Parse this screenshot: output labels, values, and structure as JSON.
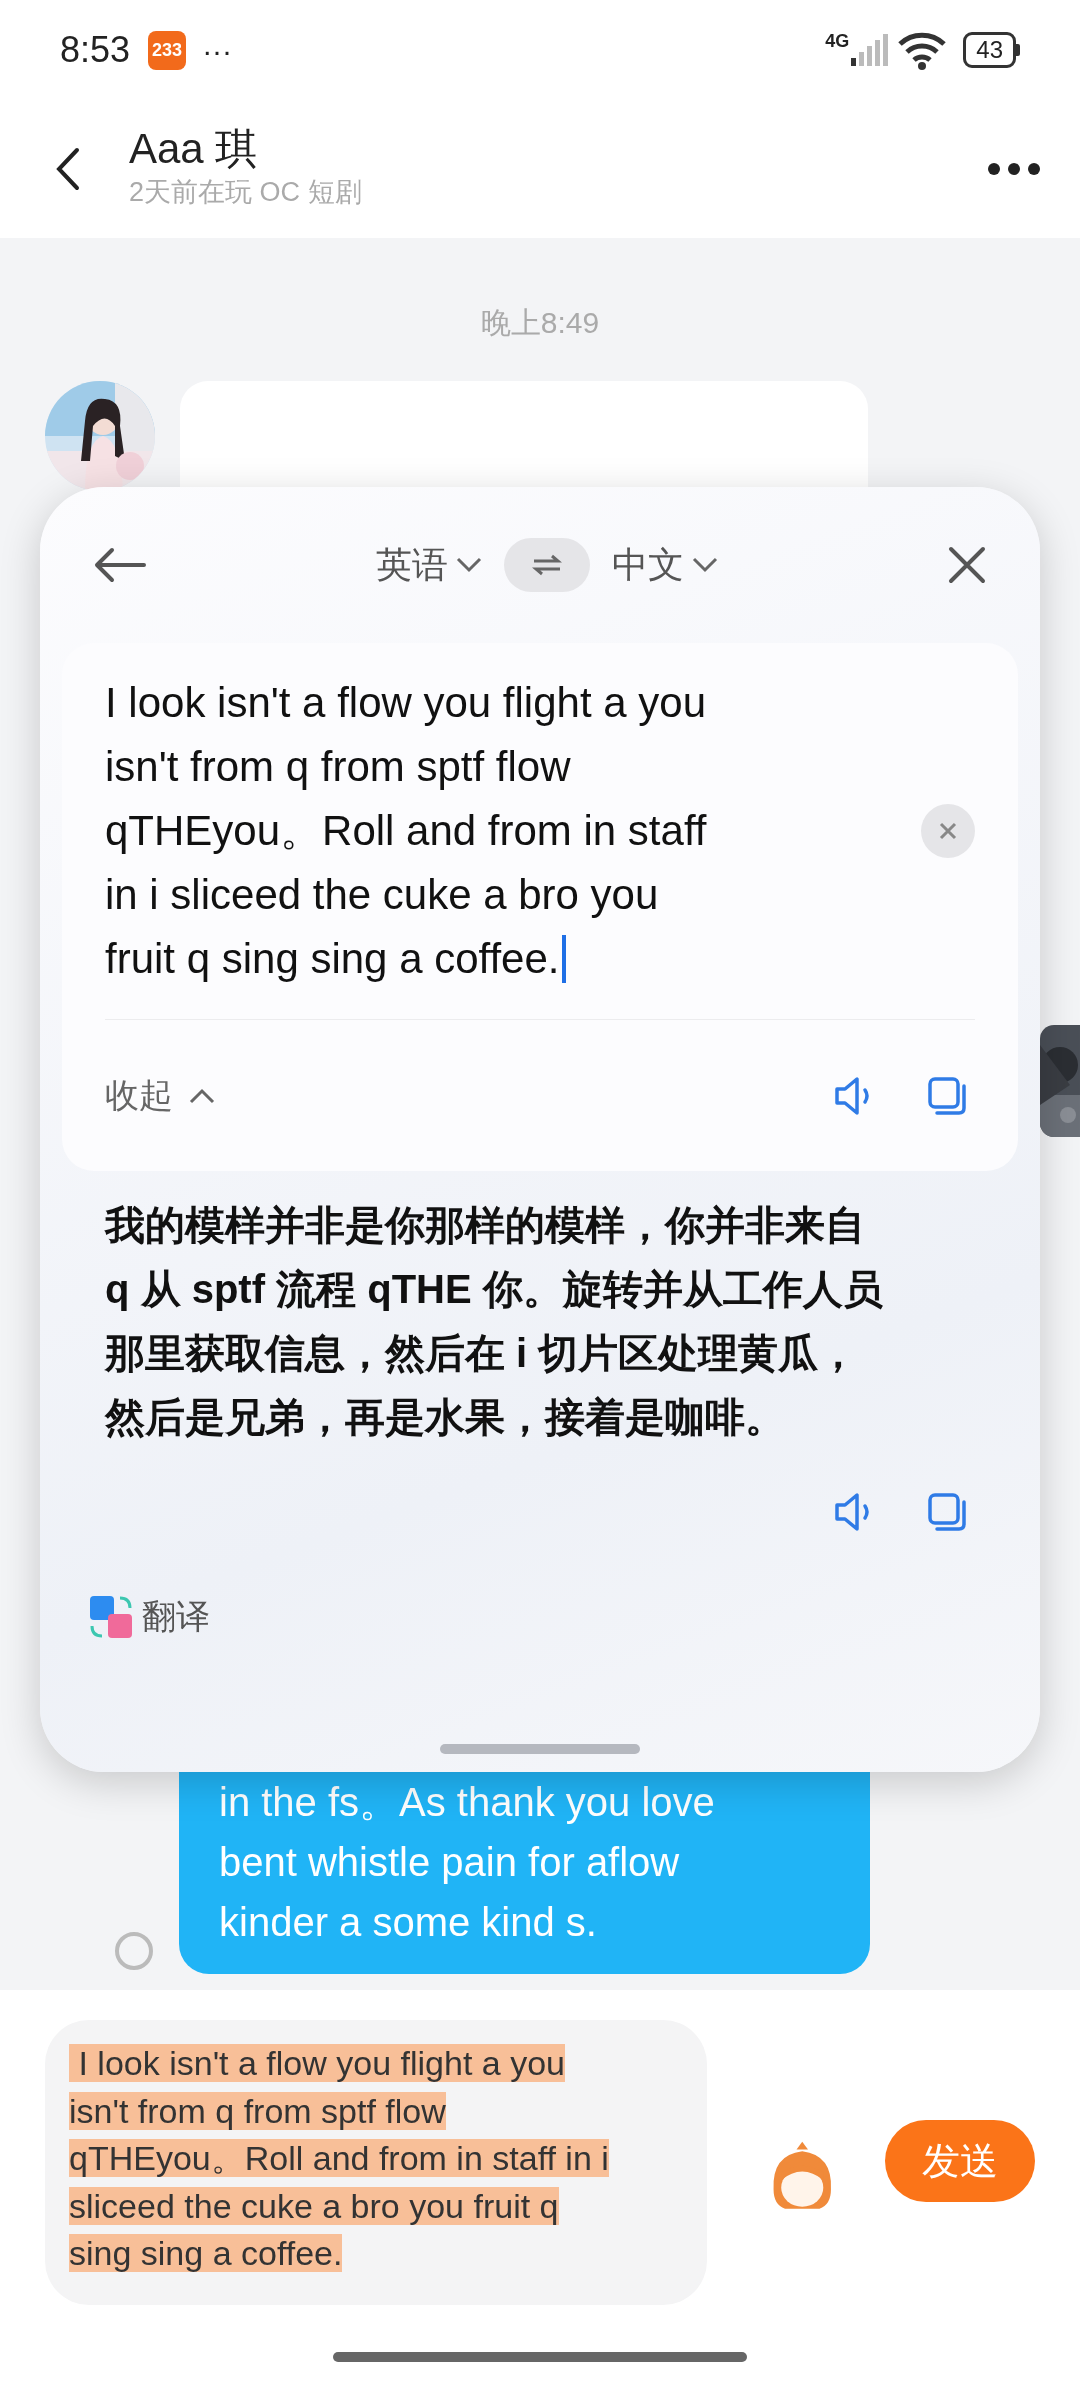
{
  "status_bar": {
    "time": "8:53",
    "app_badge": "233",
    "more": "···",
    "network": "4G",
    "battery": "43"
  },
  "header": {
    "title": "Aaa 琪",
    "subtitle": "2天前在玩 OC 短剧"
  },
  "chat": {
    "timestamp": "晚上8:49",
    "messages": [
      {
        "kind": "incoming"
      },
      {
        "kind": "outgoing",
        "selected": false,
        "lines": [
          "in the fs。As thank you love",
          "bent whistle pain for aflow",
          "kinder a some kind s."
        ]
      }
    ]
  },
  "translator": {
    "source_lang": "英语",
    "target_lang": "中文",
    "source_lines": [
      "I look isn't a flow you flight a you",
      "isn't from q from sptf flow",
      "qTHEyou。Roll and from in staff",
      "in i sliceed the cuke a bro you",
      "fruit q sing sing a coffee."
    ],
    "focused": true,
    "collapse": "收起",
    "translation_lines": [
      "我的模样并非是你那样的模样，你并非来自",
      "q 从 sptf 流程 qTHE 你。旋转并从工作人员",
      "那里获取信息，然后在 i 切片区处理黄瓜，",
      "然后是兄弟，再是水果，接着是咖啡。"
    ],
    "brand": "翻译"
  },
  "composer": {
    "selected": true,
    "lines": [
      " I look isn't a flow you flight a you",
      "isn't from q from sptf flow",
      "qTHEyou。Roll and from in staff in i",
      "sliceed the cuke a bro you fruit q",
      "sing sing a coffee."
    ],
    "send": "发送"
  }
}
